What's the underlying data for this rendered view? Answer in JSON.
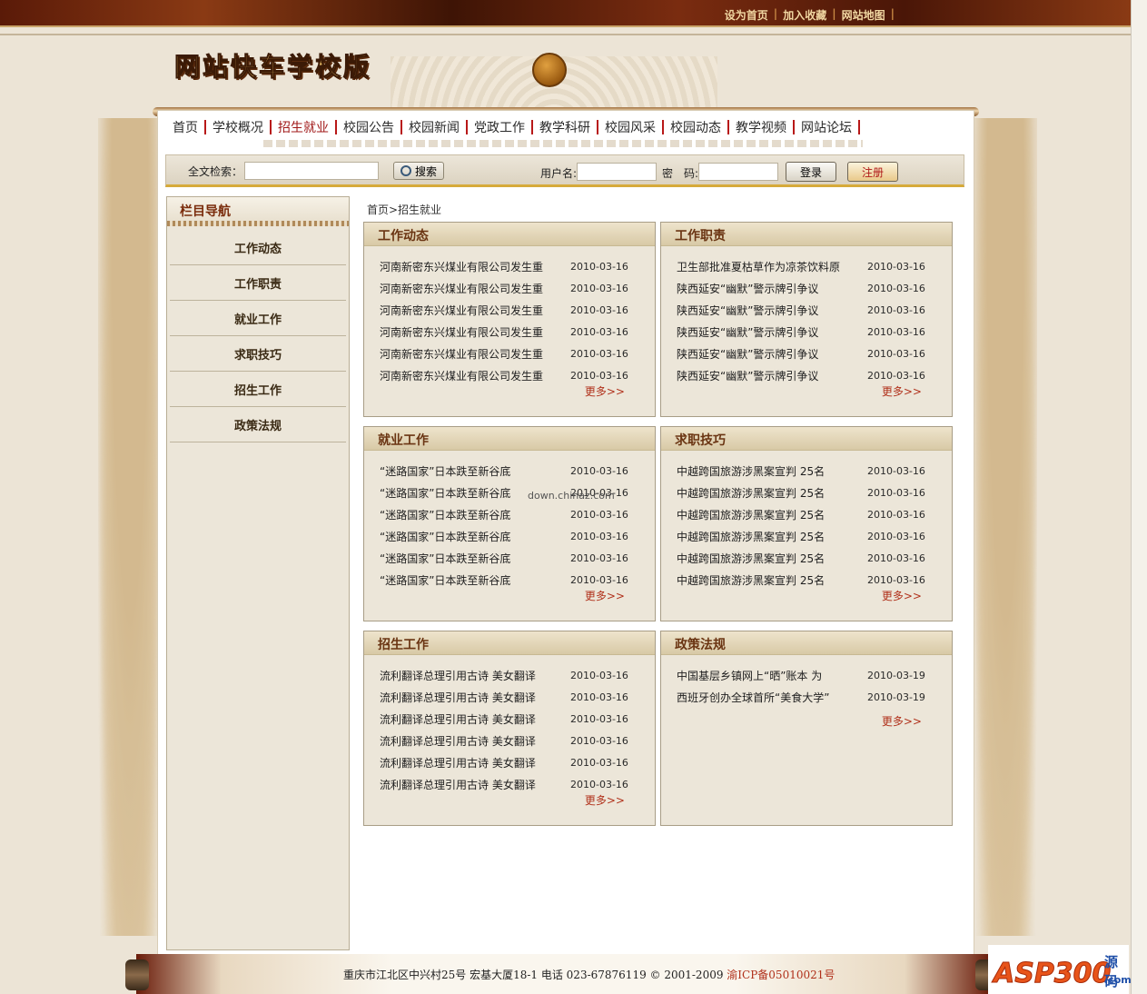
{
  "top_links": [
    "设为首页",
    "加入收藏",
    "网站地图"
  ],
  "logo_text": "网站快车学校版",
  "nav": [
    {
      "label": "首页",
      "active": false
    },
    {
      "label": "学校概况",
      "active": false
    },
    {
      "label": "招生就业",
      "active": true
    },
    {
      "label": "校园公告",
      "active": false
    },
    {
      "label": "校园新闻",
      "active": false
    },
    {
      "label": "党政工作",
      "active": false
    },
    {
      "label": "教学科研",
      "active": false
    },
    {
      "label": "校园风采",
      "active": false
    },
    {
      "label": "校园动态",
      "active": false
    },
    {
      "label": "教学视频",
      "active": false
    },
    {
      "label": "网站论坛",
      "active": false
    }
  ],
  "search": {
    "label": "全文检索：",
    "value": "",
    "button": "搜索"
  },
  "login": {
    "username_label": "用户名:",
    "password_label": "密　码:",
    "username_value": "",
    "password_value": "",
    "login_button": "登录",
    "register_button": "注册"
  },
  "sidebar": {
    "title": "栏目导航",
    "items": [
      "工作动态",
      "工作职责",
      "就业工作",
      "求职技巧",
      "招生工作",
      "政策法规"
    ]
  },
  "breadcrumb": "首页>招生就业",
  "more_label": "更多>>",
  "panels": [
    {
      "title": "工作动态",
      "items": [
        {
          "t": "河南新密东兴煤业有限公司发生重",
          "d": "2010-03-16"
        },
        {
          "t": "河南新密东兴煤业有限公司发生重",
          "d": "2010-03-16"
        },
        {
          "t": "河南新密东兴煤业有限公司发生重",
          "d": "2010-03-16"
        },
        {
          "t": "河南新密东兴煤业有限公司发生重",
          "d": "2010-03-16"
        },
        {
          "t": "河南新密东兴煤业有限公司发生重",
          "d": "2010-03-16"
        },
        {
          "t": "河南新密东兴煤业有限公司发生重",
          "d": "2010-03-16"
        }
      ]
    },
    {
      "title": "工作职责",
      "items": [
        {
          "t": "卫生部批准夏枯草作为凉茶饮料原",
          "d": "2010-03-16"
        },
        {
          "t": "陕西延安“幽默”警示牌引争议",
          "d": "2010-03-16"
        },
        {
          "t": "陕西延安“幽默”警示牌引争议",
          "d": "2010-03-16"
        },
        {
          "t": "陕西延安“幽默”警示牌引争议",
          "d": "2010-03-16"
        },
        {
          "t": "陕西延安“幽默”警示牌引争议",
          "d": "2010-03-16"
        },
        {
          "t": "陕西延安“幽默”警示牌引争议",
          "d": "2010-03-16"
        }
      ]
    },
    {
      "title": "就业工作",
      "items": [
        {
          "t": "“迷路国家”日本跌至新谷底",
          "d": "2010-03-16"
        },
        {
          "t": "“迷路国家”日本跌至新谷底",
          "d": "2010-03-16"
        },
        {
          "t": "“迷路国家”日本跌至新谷底",
          "d": "2010-03-16"
        },
        {
          "t": "“迷路国家”日本跌至新谷底",
          "d": "2010-03-16"
        },
        {
          "t": "“迷路国家”日本跌至新谷底",
          "d": "2010-03-16"
        },
        {
          "t": "“迷路国家”日本跌至新谷底",
          "d": "2010-03-16"
        }
      ]
    },
    {
      "title": "求职技巧",
      "items": [
        {
          "t": "中越跨国旅游涉黑案宣判 25名",
          "d": "2010-03-16"
        },
        {
          "t": "中越跨国旅游涉黑案宣判 25名",
          "d": "2010-03-16"
        },
        {
          "t": "中越跨国旅游涉黑案宣判 25名",
          "d": "2010-03-16"
        },
        {
          "t": "中越跨国旅游涉黑案宣判 25名",
          "d": "2010-03-16"
        },
        {
          "t": "中越跨国旅游涉黑案宣判 25名",
          "d": "2010-03-16"
        },
        {
          "t": "中越跨国旅游涉黑案宣判 25名",
          "d": "2010-03-16"
        }
      ]
    },
    {
      "title": "招生工作",
      "items": [
        {
          "t": "流利翻译总理引用古诗 美女翻译",
          "d": "2010-03-16"
        },
        {
          "t": "流利翻译总理引用古诗 美女翻译",
          "d": "2010-03-16"
        },
        {
          "t": "流利翻译总理引用古诗 美女翻译",
          "d": "2010-03-16"
        },
        {
          "t": "流利翻译总理引用古诗 美女翻译",
          "d": "2010-03-16"
        },
        {
          "t": "流利翻译总理引用古诗 美女翻译",
          "d": "2010-03-16"
        },
        {
          "t": "流利翻译总理引用古诗 美女翻译",
          "d": "2010-03-16"
        }
      ]
    },
    {
      "title": "政策法规",
      "items": [
        {
          "t": "中国基层乡镇网上“晒”账本 为",
          "d": "2010-03-19"
        },
        {
          "t": "西班牙创办全球首所“美食大学”",
          "d": "2010-03-19"
        }
      ]
    }
  ],
  "watermark": "down.chinaz.com",
  "footer": {
    "text": "重庆市江北区中兴村25号 宏基大厦18-1 电话 023-67876119 © 2001-2009 ",
    "icp": "渝ICP备05010021号"
  },
  "brand": {
    "name": "ASP300",
    "tag": "源码",
    "domain": ".com"
  },
  "colors": {
    "accent_red": "#b0301a",
    "nav_active": "#a01818",
    "header_dark": "#5a1a08",
    "gold": "#d6aa3a"
  }
}
